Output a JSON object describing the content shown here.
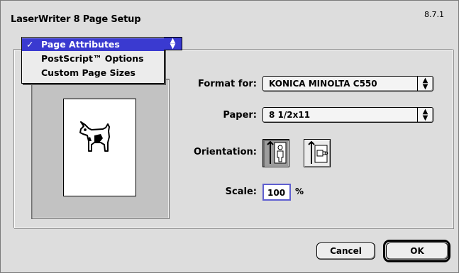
{
  "window": {
    "title": "LaserWriter 8 Page Setup",
    "version": "8.7.1"
  },
  "menu": {
    "items": [
      {
        "label": "Page Attributes",
        "checked": true,
        "check_mark": "✓"
      },
      {
        "label": "PostScript™ Options",
        "checked": false
      },
      {
        "label": "Custom Page Sizes",
        "checked": false
      }
    ],
    "arrows": "▲▼"
  },
  "form": {
    "format_for_label": "Format for:",
    "format_for_value": "KONICA MINOLTA C550",
    "paper_label": "Paper:",
    "paper_value": "8 1/2x11",
    "orientation_label": "Orientation:",
    "orientation_options": [
      {
        "name": "portrait",
        "selected": true
      },
      {
        "name": "landscape",
        "selected": false
      }
    ],
    "scale_label": "Scale:",
    "scale_value": "100",
    "scale_unit": "%"
  },
  "buttons": {
    "cancel": "Cancel",
    "ok": "OK"
  },
  "colors": {
    "highlight": "#3a3ad0",
    "background": "#dddddd"
  }
}
